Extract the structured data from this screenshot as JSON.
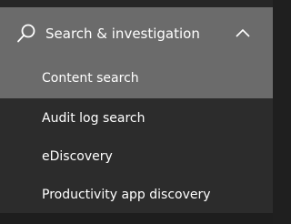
{
  "nav": {
    "group": {
      "title": "Search & investigation",
      "icon": "search-icon",
      "expand_icon": "chevron-up-icon",
      "expanded": true
    },
    "items": [
      {
        "label": "Content search",
        "selected": true
      },
      {
        "label": "Audit log search",
        "selected": false
      },
      {
        "label": "eDiscovery",
        "selected": false
      },
      {
        "label": "Productivity app discovery",
        "selected": false
      }
    ]
  },
  "colors": {
    "selected_bg": "#6b6b6b",
    "panel_bg": "#2c2c2c",
    "text": "#ffffff"
  }
}
